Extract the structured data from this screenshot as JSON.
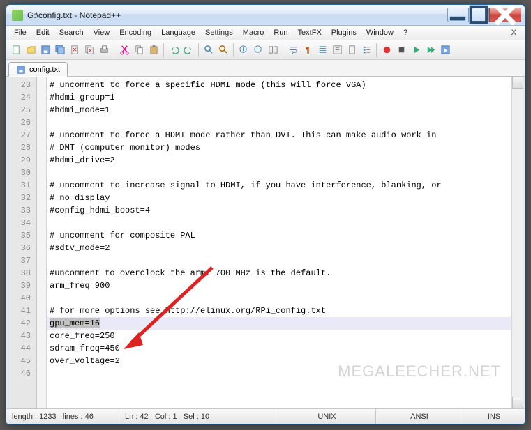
{
  "window": {
    "title": "G:\\config.txt - Notepad++"
  },
  "menu": {
    "file": "File",
    "edit": "Edit",
    "search": "Search",
    "view": "View",
    "encoding": "Encoding",
    "language": "Language",
    "settings": "Settings",
    "macro": "Macro",
    "run": "Run",
    "textfx": "TextFX",
    "plugins": "Plugins",
    "window": "Window",
    "help": "?",
    "close_x": "X"
  },
  "tab": {
    "label": "config.txt"
  },
  "gutter_start": 23,
  "lines": [
    "# uncomment to force a specific HDMI mode (this will force VGA)",
    "#hdmi_group=1",
    "#hdmi_mode=1",
    "",
    "# uncomment to force a HDMI mode rather than DVI. This can make audio work in",
    "# DMT (computer monitor) modes",
    "#hdmi_drive=2",
    "",
    "# uncomment to increase signal to HDMI, if you have interference, blanking, or",
    "# no display",
    "#config_hdmi_boost=4",
    "",
    "# uncomment for composite PAL",
    "#sdtv_mode=2",
    "",
    "#uncomment to overclock the arm. 700 MHz is the default.",
    "arm_freq=900",
    "",
    "# for more options see http://elinux.org/RPi_config.txt",
    "gpu_mem=16",
    "core_freq=250",
    "sdram_freq=450",
    "over_voltage=2",
    ""
  ],
  "highlight_line": 42,
  "selection_text": "gpu_mem=16",
  "status": {
    "length_label": "length :",
    "length_val": "1233",
    "lines_label": "lines :",
    "lines_val": "46",
    "ln_label": "Ln :",
    "ln_val": "42",
    "col_label": "Col :",
    "col_val": "1",
    "sel_label": "Sel :",
    "sel_val": "10",
    "eol": "UNIX",
    "enc": "ANSI",
    "mode": "INS"
  },
  "watermark": "MEGALEECHER.NET"
}
